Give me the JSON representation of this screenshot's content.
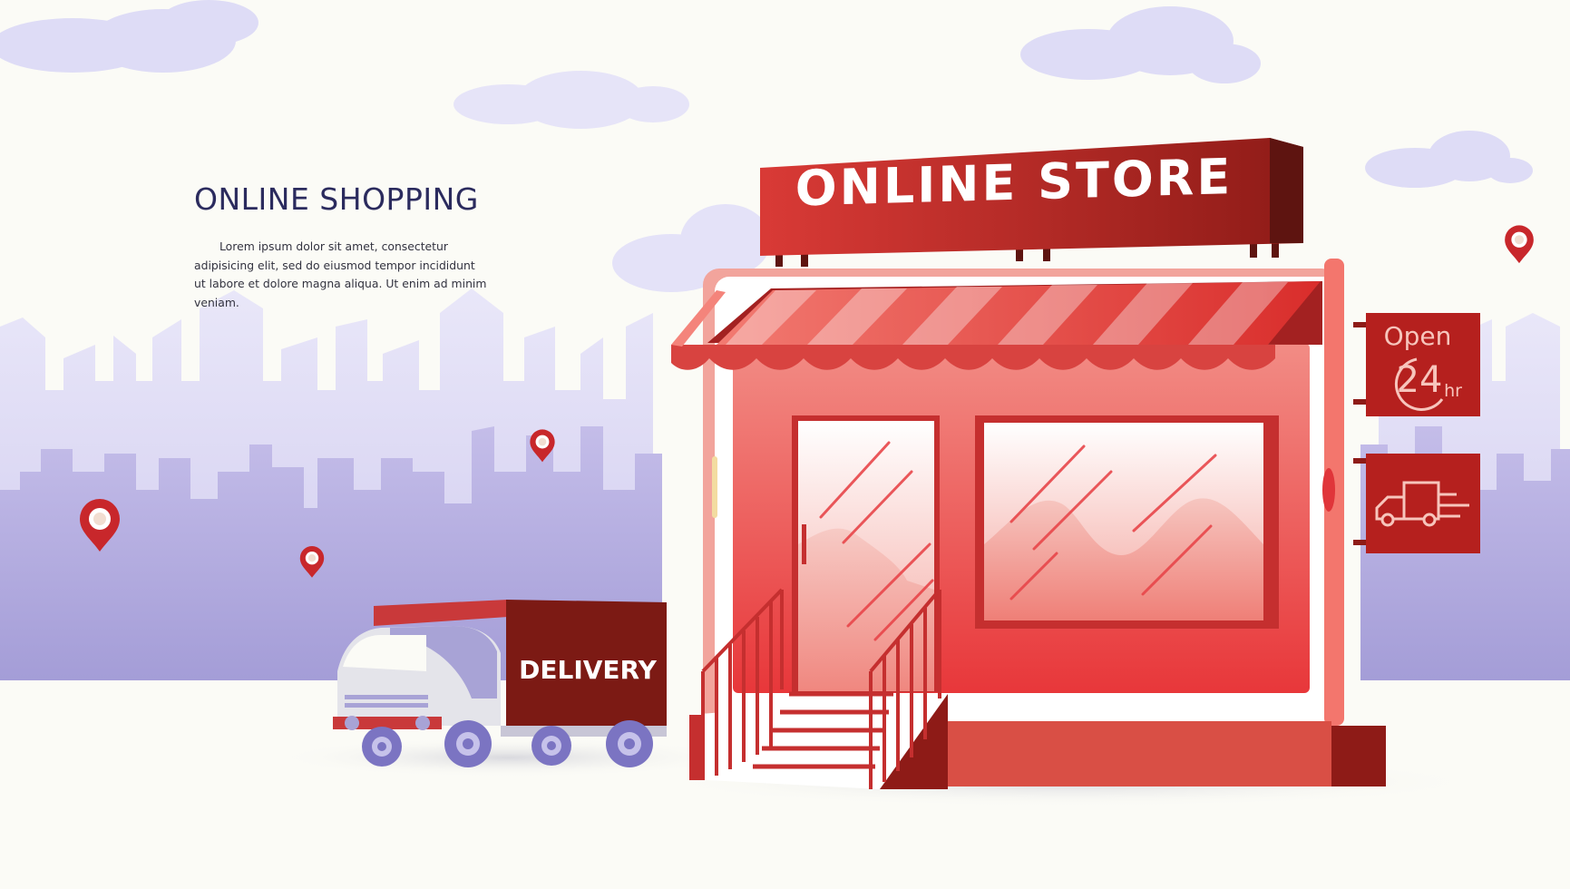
{
  "banner": {
    "headline": "ONLINE SHOPPING",
    "body": "Lorem ipsum dolor sit amet, consectetur adipisicing elit, sed do eiusmod tempor incididunt ut labore et dolore magna aliqua. Ut enim ad minim veniam."
  },
  "store": {
    "sign_text": "ONLINE STORE",
    "hours_sign": {
      "line1": "Open",
      "number": "24",
      "unit": "hr"
    },
    "delivery_sign_icon": "truck-icon"
  },
  "truck": {
    "label": "DELIVERY"
  },
  "decorations": {
    "location_pin_icons": 4,
    "cloud_count": 5
  },
  "colors": {
    "background": "#fbfbf6",
    "cloud": "#dedcf6",
    "skyline_back": "#d6d2ef",
    "skyline_front": "#a7a0d8",
    "store_red": "#e84b4b",
    "dark_red": "#8e1b17",
    "text_navy": "#2b2b5e"
  }
}
